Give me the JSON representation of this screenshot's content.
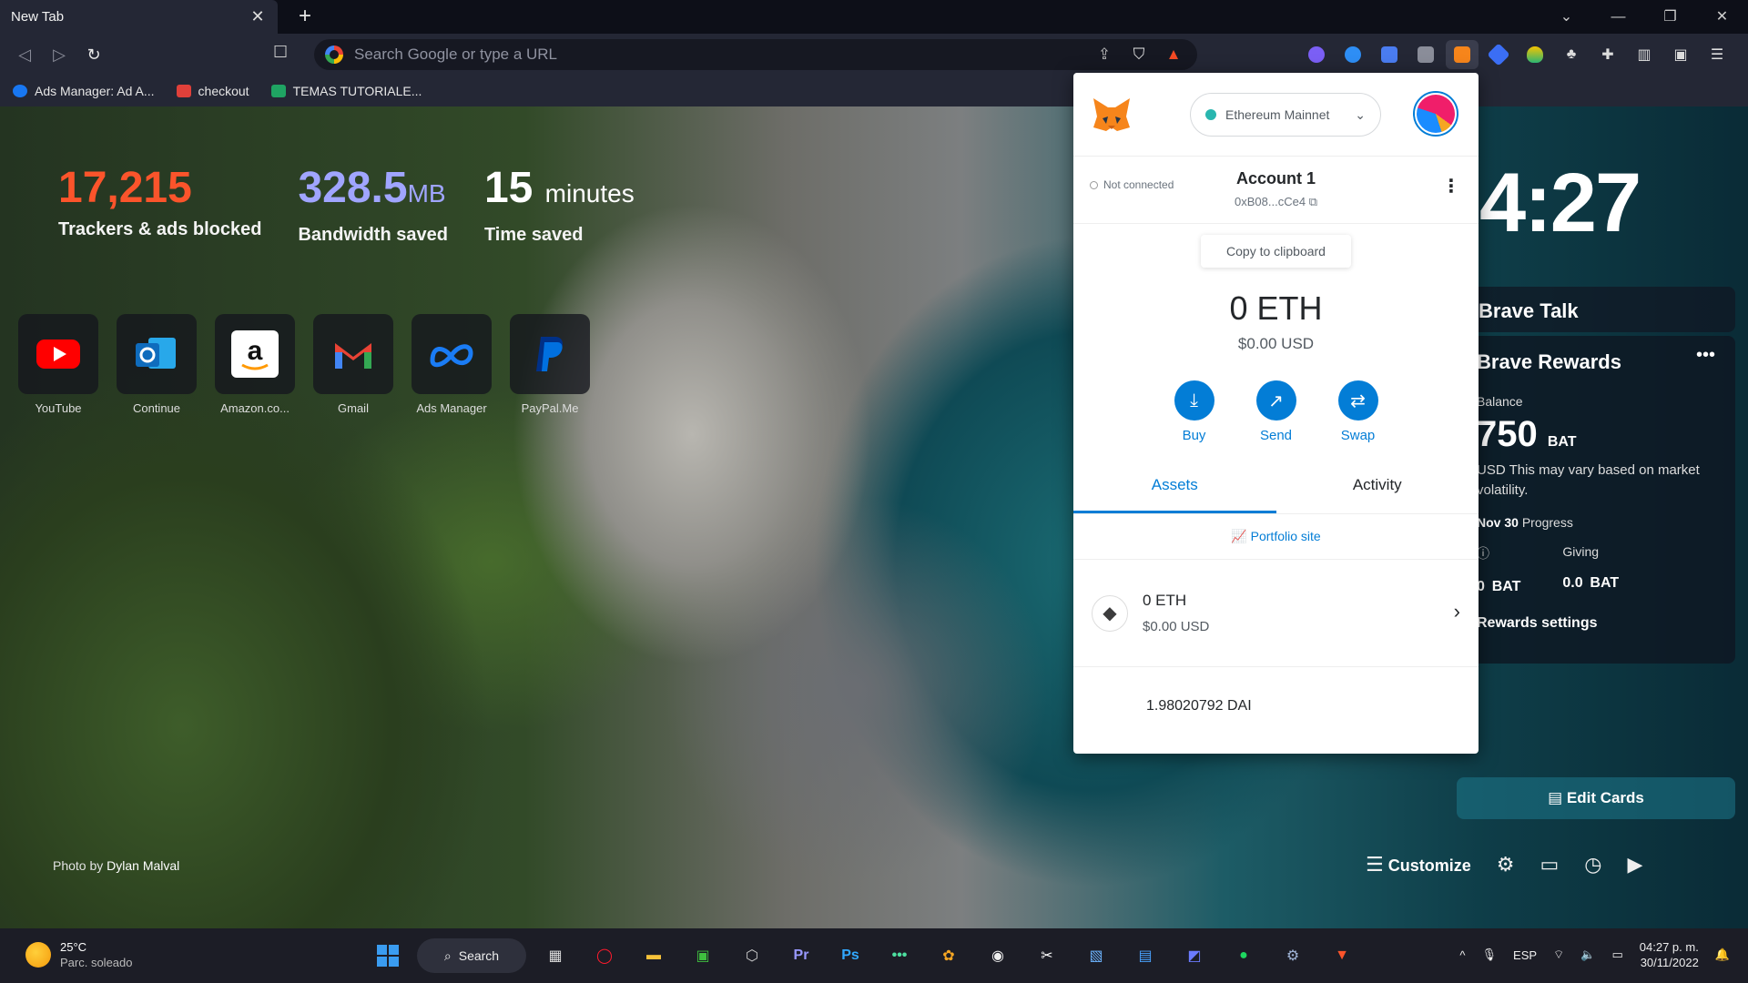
{
  "browser": {
    "tab_title": "New Tab",
    "tab_close": "✕",
    "new_tab": "+",
    "omnibox_placeholder": "Search Google or type a URL",
    "bookmarks": [
      {
        "label": "Ads Manager: Ad A...",
        "color": "#1877f2"
      },
      {
        "label": "checkout",
        "color": "#e0403a"
      },
      {
        "label": "TEMAS TUTORIALE...",
        "color": "#1fa463"
      }
    ],
    "window_controls": [
      "⌄",
      "—",
      "❐",
      "✕"
    ]
  },
  "stats": [
    {
      "value": "17,215",
      "unit": "",
      "label": "Trackers & ads blocked",
      "color": "orange"
    },
    {
      "value": "328.5",
      "unit": "MB",
      "label": "Bandwidth saved",
      "color": "purple"
    },
    {
      "value": "15",
      "unit": "minutes",
      "label": "Time saved",
      "color": "white"
    }
  ],
  "top_sites": [
    {
      "label": "YouTube",
      "icon": "youtube-icon"
    },
    {
      "label": "Continue",
      "icon": "outlook-icon"
    },
    {
      "label": "Amazon.co...",
      "icon": "amazon-icon"
    },
    {
      "label": "Gmail",
      "icon": "gmail-icon"
    },
    {
      "label": "Ads Manager",
      "icon": "meta-icon"
    },
    {
      "label": "PayPal.Me",
      "icon": "paypal-icon"
    }
  ],
  "photo_credit": {
    "prefix": "Photo by",
    "author": "Dylan Malval"
  },
  "clock": "4:27",
  "brave_talk": {
    "title": "Brave Talk"
  },
  "rewards": {
    "title": "Brave Rewards",
    "balance_label": "Balance",
    "balance_value": "750",
    "balance_unit": "BAT",
    "note": "USD This may vary based on market volatility.",
    "progress_date": "Nov 30",
    "progress_label": "Progress",
    "earning_value": "0",
    "earning_unit": "BAT",
    "giving_label": "Giving",
    "giving_value": "0.0",
    "giving_unit": "BAT",
    "settings_label": "Rewards settings"
  },
  "edit_cards": "Edit Cards",
  "customize": "Customize",
  "metamask": {
    "network": "Ethereum Mainnet",
    "connection": "Not connected",
    "account_name": "Account 1",
    "address": "0xB08...cCe4",
    "tooltip": "Copy to clipboard",
    "balance": "0 ETH",
    "balance_usd": "$0.00 USD",
    "actions": [
      {
        "label": "Buy",
        "icon": "download-icon"
      },
      {
        "label": "Send",
        "icon": "arrow-up-right-icon"
      },
      {
        "label": "Swap",
        "icon": "swap-icon"
      }
    ],
    "tabs": [
      "Assets",
      "Activity"
    ],
    "portfolio": "Portfolio site",
    "assets": [
      {
        "amount": "0 ETH",
        "usd": "$0.00 USD"
      }
    ],
    "peek_asset": "1.98020792 DAI"
  },
  "taskbar": {
    "temp": "25°C",
    "weather": "Parc. soleado",
    "search": "Search",
    "lang": "ESP",
    "time": "04:27 p. m.",
    "date": "30/11/2022"
  }
}
